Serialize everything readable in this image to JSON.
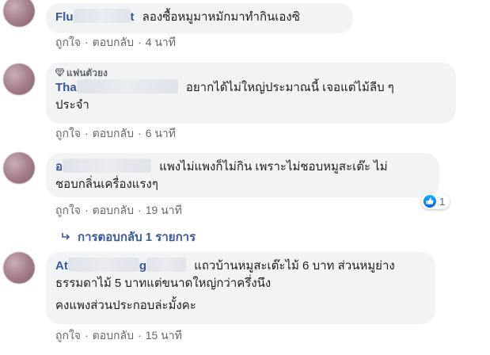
{
  "actions": {
    "like": "ถูกใจ",
    "reply": "ตอบกลับ",
    "separator": "·"
  },
  "comments": [
    {
      "name": "Flu",
      "name_tail": "t",
      "text": "ลองซื้อหมูมาหมักมาทำกินเองซิ",
      "time": "4 นาที"
    },
    {
      "badge": "แฟนตัวยง",
      "name": "Tha",
      "text_line1": "อยากได้ไม่ใหญ่ประมาณนี้ เจอแต่ไม้ลีบ ๆ",
      "text_line2": "ประจำ",
      "time": "6 นาที"
    },
    {
      "name": "อ",
      "text_line1": "แพงไม่แพงก็ไม่กิน เพราะไม่ชอบหมูสะเต๊ะ ไม่",
      "text_line2": "ชอบกลิ่นเครื่องแรงๆ",
      "time": "19 นาที",
      "reaction_count": "1"
    },
    {
      "name": "At",
      "name_tail": "g",
      "text_line1": "แถวบ้านหมูสะเต๊ะไม้ 6 บาท ส่วนหมูย่าง",
      "text_line2": "ธรรมดาไม้ 5 บาทแต่ขนาดใหญ่กว่าครึ่งนึง",
      "text_line3": "คงแพงส่วนประกอบล่ะมั้งคะ",
      "time": "15 นาที"
    }
  ],
  "replies_link": "การตอบกลับ 1 รายการ",
  "colors": {
    "name": "#385898",
    "bubble": "#f2f3f5",
    "meta": "#606770",
    "like": "#1877f2"
  }
}
